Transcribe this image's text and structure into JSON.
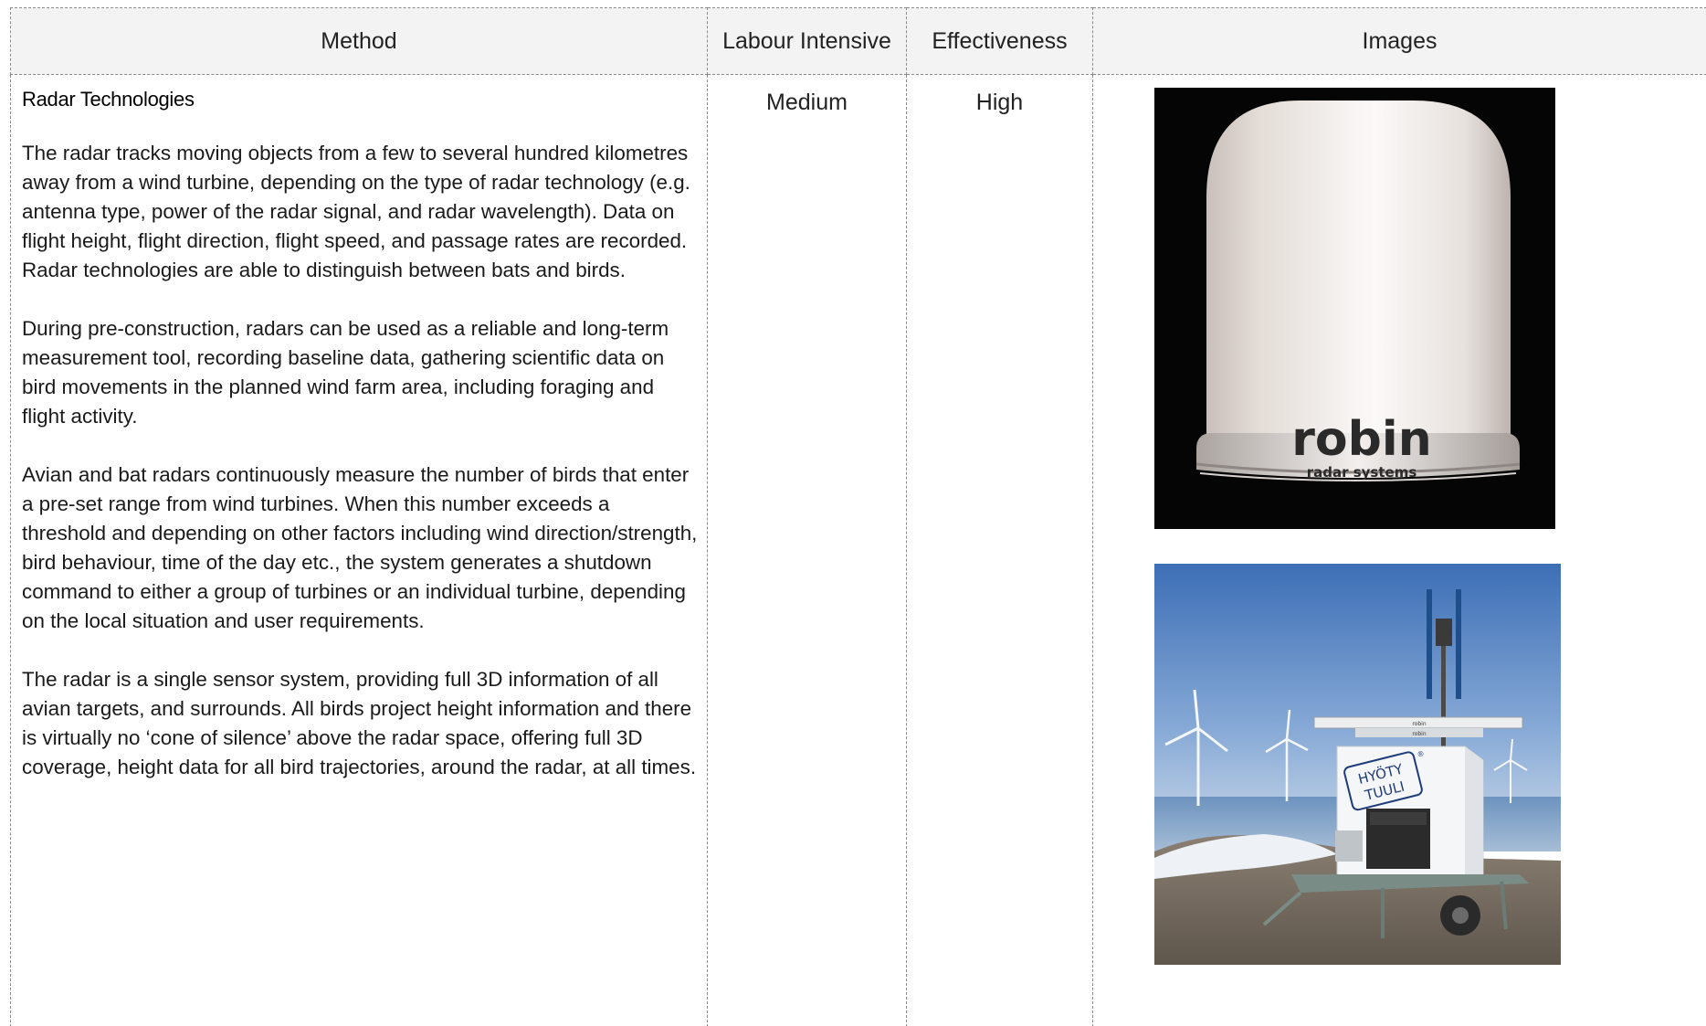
{
  "table": {
    "headers": [
      "Method",
      "Labour Intensive",
      "Effectiveness",
      "Images"
    ],
    "rows": [
      {
        "method_title": "Radar Technologies",
        "paragraphs": [
          "The radar tracks moving objects from a few to several hundred kilometres away from a wind turbine, depending on the type of radar technology (e.g. antenna type, power of the radar signal, and radar wavelength). Data on flight height, flight direction, flight speed, and passage rates are recorded. Radar technologies are able to distinguish between bats and birds.",
          "During pre-construction, radars can be used as a reliable and long-term measurement tool, recording baseline data, gathering scientific data on bird movements in the planned wind farm area, including foraging and flight activity.",
          "Avian and bat radars continuously measure the number of birds that enter a pre-set range from wind turbines. When this number exceeds a threshold and depending on other factors including wind direction/strength, bird behaviour, time of the day etc., the system generates a shutdown command to either a group of turbines or an individual turbine, depending on the local situation and user requirements.",
          "The radar is a single sensor system, providing full 3D information of all avian targets, and surrounds. All birds project height information and there is virtually no ‘cone of silence’ above the radar space, offering full 3D coverage, height data for all bird trajectories, around the radar, at all times."
        ],
        "labour_intensive": "Medium",
        "effectiveness": "High"
      }
    ]
  },
  "images": {
    "radar_logo": "robin",
    "radar_logo_sub": "radar systems",
    "trailer_sign_line1": "HYÖTY",
    "trailer_sign_line2": "TUULI",
    "trailer_sign_mark": "®",
    "trailer_small_label_1": "robin",
    "trailer_small_label_2": "robin"
  }
}
